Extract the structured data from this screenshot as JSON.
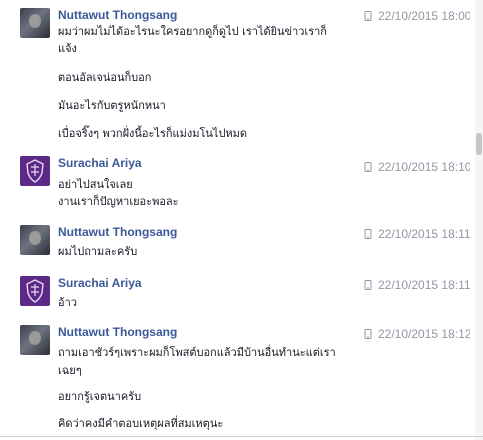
{
  "messages": [
    {
      "author": "Nuttawut Thongsang",
      "timestamp": "22/10/2015 18:00",
      "avatar": "user-photo-avatar",
      "lines": [
        "ผมว่าผมไม่ได้อะไรนะใครอยากดูก็ดูไป เราได้ยินข่าวเราก็",
        "แจ้ง",
        "ตอนอัลเจน่อนก็บอก",
        "มันอะไรกับตรูหนักหนา",
        "เบื่อจริ๊งๆ พวกฝั่งนี้อะไรก็แม่งมโนไปหมด"
      ]
    },
    {
      "author": "Surachai Ariya",
      "timestamp": "22/10/2015 18:10",
      "avatar": "crest-avatar",
      "lines": [
        "อย่าไปสนใจเลย",
        "งานเราก็ปัญหาเยอะพอละ"
      ]
    },
    {
      "author": "Nuttawut Thongsang",
      "timestamp": "22/10/2015 18:11",
      "avatar": "user-photo-avatar",
      "lines": [
        "ผมไปถามละครับ"
      ]
    },
    {
      "author": "Surachai Ariya",
      "timestamp": "22/10/2015 18:11",
      "avatar": "crest-avatar",
      "lines": [
        "อ้าว"
      ]
    },
    {
      "author": "Nuttawut Thongsang",
      "timestamp": "22/10/2015 18:12",
      "avatar": "user-photo-avatar",
      "lines": [
        "ถามเอาชัวร์ๆเพราะผมก็โพสต์บอกแล้วมีบ้านอื่นทำนะแต่เรา",
        "เฉยๆ",
        "อยากรู้เจตนาครับ",
        "คิดว่าคงมีคำตอบเหตุผลที่สมเหตุนะ"
      ]
    }
  ]
}
